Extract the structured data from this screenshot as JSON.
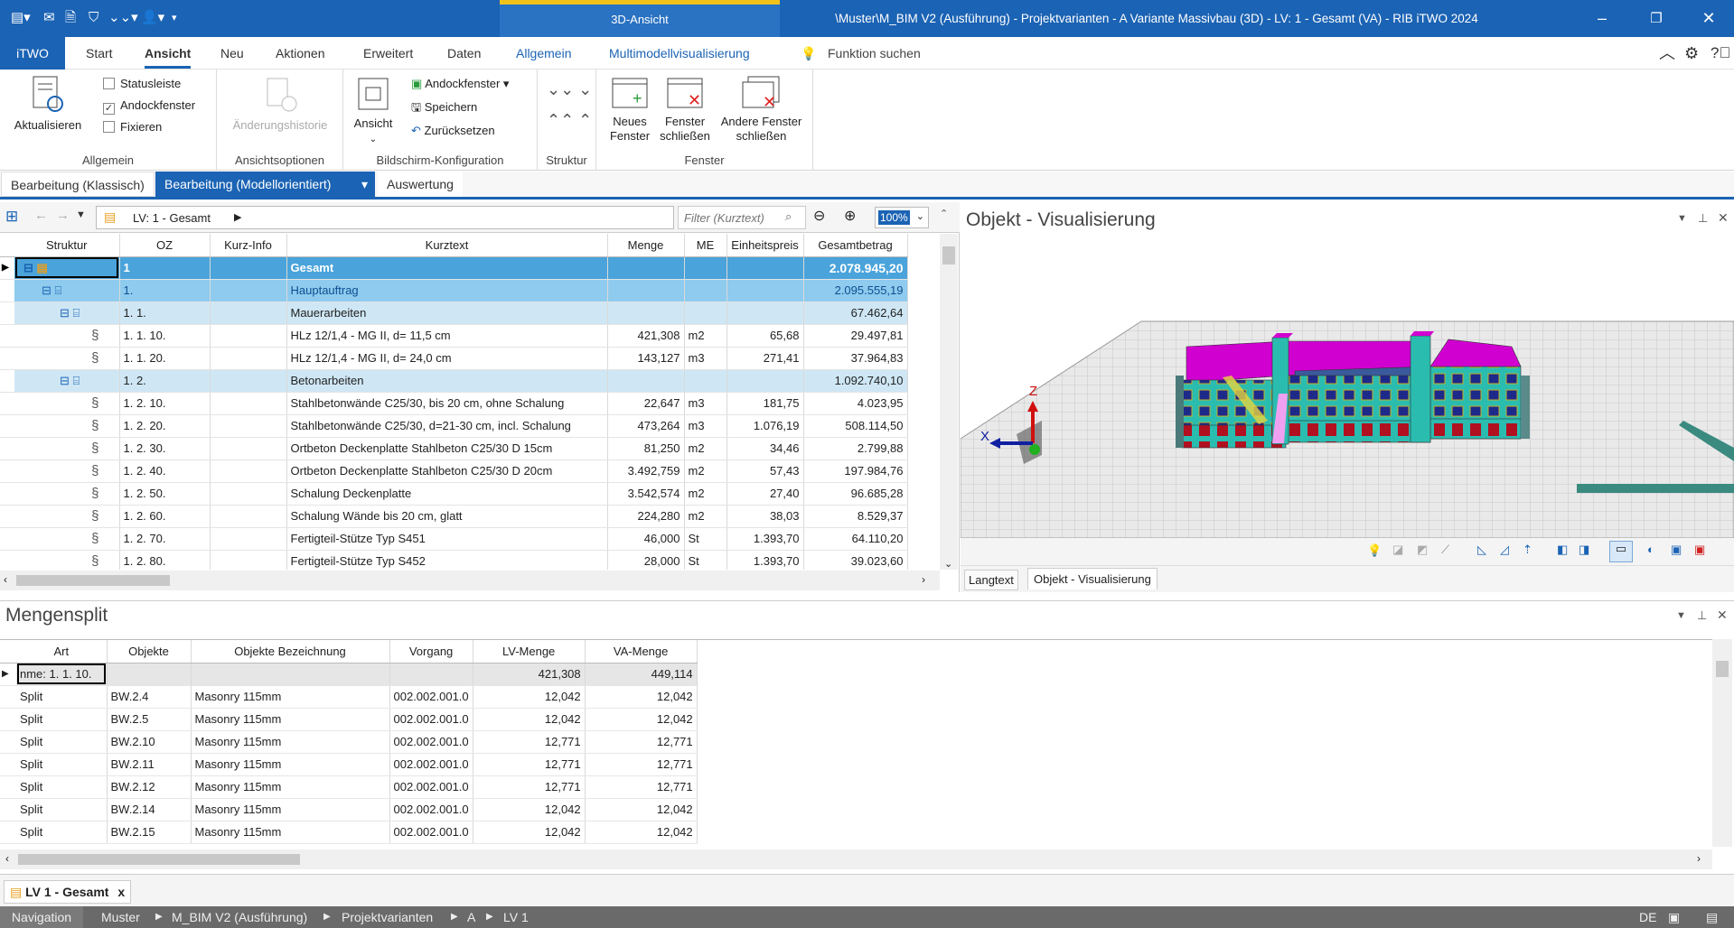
{
  "titlebar": {
    "context_tab": "3D-Ansicht",
    "window_title": "\\Muster\\M_BIM V2 (Ausführung) - Projektvarianten - A Variante Massivbau (3D) - LV: 1 - Gesamt (VA) - RIB iTWO 2024"
  },
  "ribbon_tabs": [
    {
      "label": "iTWO"
    },
    {
      "label": "Start"
    },
    {
      "label": "Ansicht"
    },
    {
      "label": "Neu"
    },
    {
      "label": "Aktionen"
    },
    {
      "label": "Erweitert"
    },
    {
      "label": "Daten"
    },
    {
      "label": "Allgemein"
    },
    {
      "label": "Multimodellvisualisierung"
    }
  ],
  "search_label": "Funktion suchen",
  "ribbon": {
    "aktualisieren": "Aktualisieren",
    "statusleiste": "Statusleiste",
    "andockfenster": "Andockfenster",
    "fixieren": "Fixieren",
    "grp_allgemein": "Allgemein",
    "aenderungshistorie": "Änderungshistorie",
    "grp_ansichtsoptionen": "Ansichtsoptionen",
    "ansicht": "Ansicht",
    "andockfenster_dd": "Andockfenster",
    "speichern": "Speichern",
    "zuruecksetzen": "Zurücksetzen",
    "grp_bildschirm": "Bildschirm-Konfiguration",
    "grp_struktur": "Struktur",
    "neues_fenster_1": "Neues",
    "neues_fenster_2": "Fenster",
    "fenster_schliessen_1": "Fenster",
    "fenster_schliessen_2": "schließen",
    "andere_fenster_1": "Andere Fenster",
    "andere_fenster_2": "schließen",
    "grp_fenster": "Fenster"
  },
  "mode_tabs": [
    {
      "label": "Bearbeitung (Klassisch)"
    },
    {
      "label": "Bearbeitung (Modellorientiert)"
    },
    {
      "label": "Auswertung"
    }
  ],
  "lv": {
    "breadcrumb": "LV: 1 - Gesamt",
    "filter_placeholder": "Filter (Kurztext)",
    "zoom": "100%",
    "columns": [
      "Struktur",
      "OZ",
      "Kurz-Info",
      "Kurztext",
      "Menge",
      "ME",
      "Einheitspreis",
      "Gesamtbetrag"
    ],
    "rows": [
      {
        "level": 0,
        "oz": "1",
        "kurztext": "Gesamt",
        "menge": "",
        "me": "",
        "ep": "",
        "gb": "2.078.945,20"
      },
      {
        "level": 1,
        "oz": "1.",
        "kurztext": "Hauptauftrag",
        "menge": "",
        "me": "",
        "ep": "",
        "gb": "2.095.555,19"
      },
      {
        "level": 2,
        "oz": "1. 1.",
        "kurztext": "Mauerarbeiten",
        "menge": "",
        "me": "",
        "ep": "",
        "gb": "67.462,64"
      },
      {
        "level": 3,
        "oz": "1. 1. 10.",
        "kurztext": "HLz 12/1,4 - MG II, d= 11,5 cm",
        "menge": "421,308",
        "me": "m2",
        "ep": "65,68",
        "gb": "29.497,81"
      },
      {
        "level": 3,
        "oz": "1. 1. 20.",
        "kurztext": "HLz 12/1,4 - MG II, d= 24,0 cm",
        "menge": "143,127",
        "me": "m3",
        "ep": "271,41",
        "gb": "37.964,83"
      },
      {
        "level": 2,
        "oz": "1. 2.",
        "kurztext": "Betonarbeiten",
        "menge": "",
        "me": "",
        "ep": "",
        "gb": "1.092.740,10"
      },
      {
        "level": 3,
        "oz": "1. 2. 10.",
        "kurztext": "Stahlbetonwände  C25/30, bis 20 cm, ohne Schalung",
        "menge": "22,647",
        "me": "m3",
        "ep": "181,75",
        "gb": "4.023,95"
      },
      {
        "level": 3,
        "oz": "1. 2. 20.",
        "kurztext": "Stahlbetonwände C25/30, d=21-30 cm, incl. Schalung",
        "menge": "473,264",
        "me": "m3",
        "ep": "1.076,19",
        "gb": "508.114,50"
      },
      {
        "level": 3,
        "oz": "1. 2. 30.",
        "kurztext": "Ortbeton Deckenplatte Stahlbeton C25/30 D 15cm",
        "menge": "81,250",
        "me": "m2",
        "ep": "34,46",
        "gb": "2.799,88"
      },
      {
        "level": 3,
        "oz": "1. 2. 40.",
        "kurztext": "Ortbeton Deckenplatte Stahlbeton C25/30 D 20cm",
        "menge": "3.492,759",
        "me": "m2",
        "ep": "57,43",
        "gb": "197.984,76"
      },
      {
        "level": 3,
        "oz": "1. 2. 50.",
        "kurztext": "Schalung Deckenplatte",
        "menge": "3.542,574",
        "me": "m2",
        "ep": "27,40",
        "gb": "96.685,28"
      },
      {
        "level": 3,
        "oz": "1. 2. 60.",
        "kurztext": "Schalung Wände bis 20 cm, glatt",
        "menge": "224,280",
        "me": "m2",
        "ep": "38,03",
        "gb": "8.529,37"
      },
      {
        "level": 3,
        "oz": "1. 2. 70.",
        "kurztext": "Fertigteil-Stütze Typ S451",
        "menge": "46,000",
        "me": "St",
        "ep": "1.393,70",
        "gb": "64.110,20"
      },
      {
        "level": 3,
        "oz": "1. 2. 80.",
        "kurztext": "Fertigteil-Stütze Typ S452",
        "menge": "28,000",
        "me": "St",
        "ep": "1.393,70",
        "gb": "39.023,60"
      }
    ]
  },
  "vis": {
    "title": "Objekt - Visualisierung",
    "tab_langtext": "Langtext",
    "tab_vis": "Objekt - Visualisierung",
    "axis_x": "X",
    "axis_z": "Z"
  },
  "mengensplit": {
    "title": "Mengensplit",
    "columns": [
      "Art",
      "Objekte",
      "Objekte Bezeichnung",
      "Vorgang",
      "LV-Menge",
      "VA-Menge"
    ],
    "rows": [
      {
        "art": "nme:  1. 1.  10.",
        "obj": "",
        "bez": "",
        "vorg": "",
        "lv": "421,308",
        "va": "449,114"
      },
      {
        "art": "Split",
        "obj": "BW.2.4",
        "bez": "Masonry 115mm",
        "vorg": "002.002.001.0",
        "lv": "12,042",
        "va": "12,042"
      },
      {
        "art": "Split",
        "obj": "BW.2.5",
        "bez": "Masonry 115mm",
        "vorg": "002.002.001.0",
        "lv": "12,042",
        "va": "12,042"
      },
      {
        "art": "Split",
        "obj": "BW.2.10",
        "bez": "Masonry 115mm",
        "vorg": "002.002.001.0",
        "lv": "12,771",
        "va": "12,771"
      },
      {
        "art": "Split",
        "obj": "BW.2.11",
        "bez": "Masonry 115mm",
        "vorg": "002.002.001.0",
        "lv": "12,771",
        "va": "12,771"
      },
      {
        "art": "Split",
        "obj": "BW.2.12",
        "bez": "Masonry 115mm",
        "vorg": "002.002.001.0",
        "lv": "12,771",
        "va": "12,771"
      },
      {
        "art": "Split",
        "obj": "BW.2.14",
        "bez": "Masonry 115mm",
        "vorg": "002.002.001.0",
        "lv": "12,042",
        "va": "12,042"
      },
      {
        "art": "Split",
        "obj": "BW.2.15",
        "bez": "Masonry 115mm",
        "vorg": "002.002.001.0",
        "lv": "12,042",
        "va": "12,042"
      }
    ]
  },
  "doc_tab": {
    "label": "LV 1 - Gesamt",
    "close": "x"
  },
  "statusbar": {
    "navigation": "Navigation",
    "crumbs": [
      "Muster",
      "M_BIM V2 (Ausführung)",
      "Projektvarianten",
      "A",
      "LV 1"
    ],
    "lang": "DE"
  },
  "colors": {
    "brand": "#1b63b4",
    "row_l0": "#4aa3da",
    "row_l1": "#8ecbee",
    "row_l2": "#cfe7f5",
    "roof": "#e000e0",
    "wall": "#2bbcb0"
  }
}
